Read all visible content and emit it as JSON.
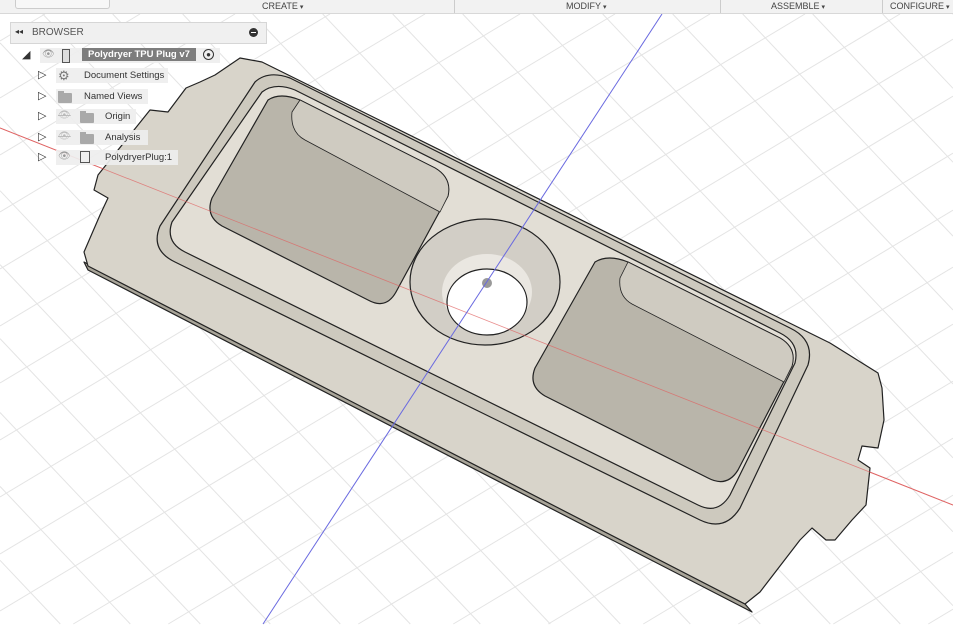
{
  "toolbar": {
    "menus": [
      {
        "label": "CREATE"
      },
      {
        "label": "MODIFY"
      },
      {
        "label": "ASSEMBLE"
      },
      {
        "label": "CONFIGURE"
      }
    ],
    "dropdown_glyph": "▾"
  },
  "browser": {
    "title": "BROWSER",
    "root": {
      "label": "Polydryer TPU Plug v7"
    },
    "items": [
      {
        "label": "Document Settings",
        "icon": "gear-icon"
      },
      {
        "label": "Named Views",
        "icon": "folder-icon"
      },
      {
        "label": "Origin",
        "icon": "folder-icon",
        "visibility": "hidden"
      },
      {
        "label": "Analysis",
        "icon": "folder-icon",
        "visibility": "hidden"
      },
      {
        "label": "PolydryerPlug:1",
        "icon": "component-icon",
        "visibility": "visible"
      }
    ]
  },
  "colors": {
    "model": "#d6d2c8",
    "x_axis": "#e05050",
    "y_axis": "#5050e0",
    "grid": "#e2e2e2"
  }
}
